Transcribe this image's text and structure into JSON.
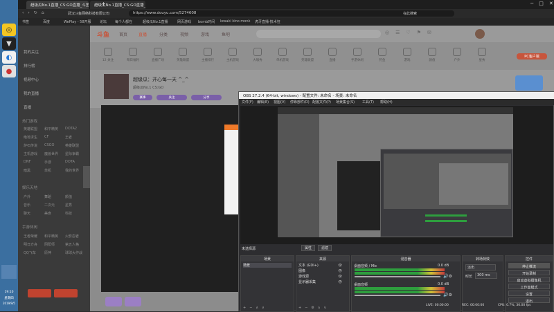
{
  "browser": {
    "tabs": [
      {
        "label": "超级瓜No.1直播_CS:GO直播_斗鱼直"
      },
      {
        "label": "超级瓜No.1直播_CS:GO直播_斗鱼直"
      }
    ],
    "company": "武汉斗鱼网络科技有限公司",
    "url": "https://www.douyu.com/5274608",
    "search_placeholder": "在此搜索",
    "bookmarks": [
      "书签",
      "百度",
      "WePlay - 58开服",
      "论坛",
      "每个人都在",
      "超级瓜No.1直播",
      "网页游戏",
      "bomb时间",
      "kosaki kino monk",
      "虎牙直播-技术狂"
    ]
  },
  "douyu": {
    "logo": "斗鱼",
    "nav": [
      "首页",
      "直播",
      "分类",
      "视频",
      "游戏",
      "鱼吧"
    ],
    "sidebar": {
      "items": [
        "我的关注",
        "排行榜",
        "视频中心",
        "我的直播",
        "直播"
      ],
      "sections": [
        {
          "title": "热门游戏",
          "cells": [
            "英雄联盟",
            "和平精英",
            "DOTA2",
            "绝地求生",
            "CF",
            "王者",
            "炉石传说",
            "CSGO",
            "英雄联盟",
            "主机游戏",
            "魔兽世界",
            "星际争霸",
            "DNF",
            "手游",
            "DOTA",
            "暗黑",
            "单机",
            "我的世界"
          ]
        },
        {
          "title": "娱乐天地",
          "cells": [
            "户外",
            "舞蹈",
            "颜值",
            "音乐",
            "二次元",
            "星秀",
            "聊天",
            "美食",
            "科技"
          ]
        },
        {
          "title": "手游休闲",
          "cells": [
            "王者荣耀",
            "和平精英",
            "火影忍者",
            "明日方舟",
            "阴阳师",
            "第五人格",
            "QQ飞车",
            "原神",
            "球球大作战"
          ]
        }
      ],
      "clock_time": "19:10",
      "clock_day": "星期四",
      "clock_date": "2019/9/5"
    },
    "categories": [
      "12 关注",
      "每日福利",
      "直播广场",
      "英雄联盟",
      "主播排行",
      "主机游戏",
      "大咖秀",
      "单机游戏",
      "英雄联盟",
      "直播",
      "手游休闲",
      "钓鱼",
      "游戏",
      "颜值",
      "户外",
      "星秀"
    ],
    "pc_client": "PC客户端",
    "room_title": "超级瓜：开心每一天 ^_^",
    "room_sub": "超级瓜No.1 CS:GO",
    "room_tag1": "赛事",
    "room_tag2": "关注",
    "room_tag3": "分享"
  },
  "obs": {
    "title": "OBS 27.2.4 (64-bit, windows) - 配置文件: 未命名 - 场景: 未命名",
    "menu": [
      "文件(F)",
      "编辑(E)",
      "视图(V)",
      "停靠部件(D)",
      "配置文件(P)",
      "场景集合(S)",
      "工具(T)",
      "帮助(H)"
    ],
    "source_selected": "未选择源",
    "btn_properties": "属性",
    "btn_filters": "滤镜",
    "docks": {
      "scenes": "场景",
      "sources": "来源",
      "mixer": "混音器",
      "transitions": "转场特效",
      "controls": "控件"
    },
    "scenes": [
      "场景"
    ],
    "sources": [
      "文本 (GDI+)",
      "图像",
      "游戏源",
      "显示器采集"
    ],
    "mixer": [
      {
        "name": "桌面音频 / Mic",
        "db": "0.0 dB"
      },
      {
        "name": "桌面音频",
        "db": "0.0 dB"
      }
    ],
    "transition": "淡出",
    "duration_label": "时长",
    "duration": "300 ms",
    "controls": [
      "停止推流",
      "开始录制",
      "启动虚拟摄像机",
      "工作室模式",
      "设置",
      "退出"
    ],
    "status": {
      "live": "LIVE: 00:00:00",
      "rec": "REC: 00:00:00",
      "cpu": "CPU: 0.7%, 30.00 fps"
    }
  }
}
